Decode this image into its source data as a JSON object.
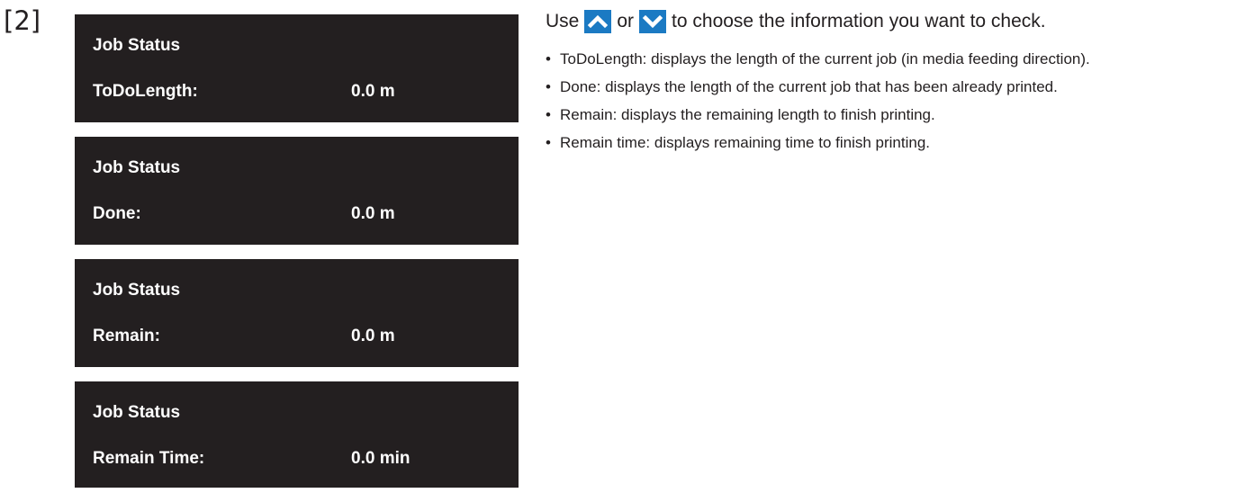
{
  "step_number": "[2]",
  "panels": [
    {
      "title": "Job Status",
      "label": "ToDoLength:",
      "value": "0.0 m"
    },
    {
      "title": "Job Status",
      "label": "Done:",
      "value": "0.0 m"
    },
    {
      "title": "Job Status",
      "label": "Remain:",
      "value": "0.0 m"
    },
    {
      "title": "Job Status",
      "label": "Remain Time:",
      "value": "0.0 min"
    }
  ],
  "instructions": {
    "lead_before": "Use",
    "lead_middle": "or",
    "lead_after": "to choose the information you want to check.",
    "up_icon": "up-arrow-key-icon",
    "down_icon": "down-arrow-key-icon",
    "key_color": "#1b7ac3",
    "bullets": [
      "ToDoLength: displays the length of the current job (in media feeding direction).",
      "Done: displays the length of the current job that has been already printed.",
      "Remain: displays the remaining length to finish printing.",
      "Remain time: displays remaining time to finish printing."
    ]
  }
}
